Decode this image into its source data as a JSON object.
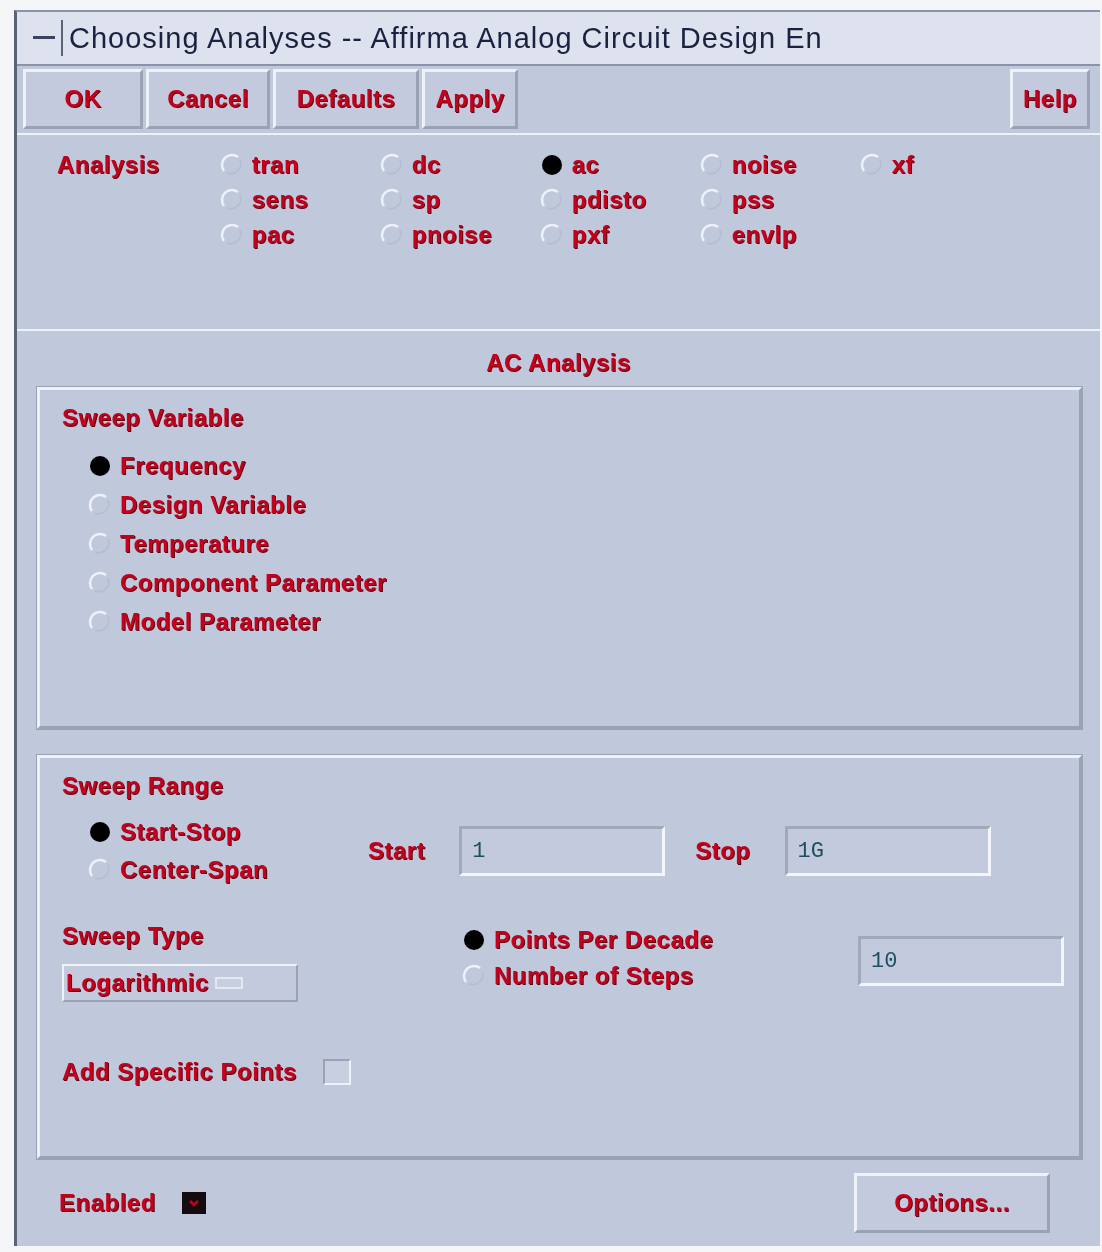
{
  "window": {
    "title": "Choosing Analyses -- Affirma Analog Circuit Design En"
  },
  "toolbar": {
    "left": [
      "OK",
      "Cancel",
      "Defaults",
      "Apply"
    ],
    "right": [
      "Help"
    ]
  },
  "analysis": {
    "label": "Analysis",
    "rows": [
      [
        {
          "label": "tran",
          "selected": false
        },
        {
          "label": "dc",
          "selected": false
        },
        {
          "label": "ac",
          "selected": true
        },
        {
          "label": "noise",
          "selected": false
        },
        {
          "label": "xf",
          "selected": false
        }
      ],
      [
        {
          "label": "sens",
          "selected": false
        },
        {
          "label": "sp",
          "selected": false
        },
        {
          "label": "pdisto",
          "selected": false
        },
        {
          "label": "pss",
          "selected": false
        }
      ],
      [
        {
          "label": "pac",
          "selected": false
        },
        {
          "label": "pnoise",
          "selected": false
        },
        {
          "label": "pxf",
          "selected": false
        },
        {
          "label": "envlp",
          "selected": false
        }
      ]
    ]
  },
  "section_title": "AC Analysis",
  "sweep_variable": {
    "title": "Sweep Variable",
    "options": [
      {
        "label": "Frequency",
        "selected": true
      },
      {
        "label": "Design Variable",
        "selected": false
      },
      {
        "label": "Temperature",
        "selected": false
      },
      {
        "label": "Component Parameter",
        "selected": false
      },
      {
        "label": "Model Parameter",
        "selected": false
      }
    ]
  },
  "sweep_range": {
    "title": "Sweep Range",
    "options": [
      {
        "label": "Start-Stop",
        "selected": true
      },
      {
        "label": "Center-Span",
        "selected": false
      }
    ],
    "start": {
      "label": "Start",
      "value": "1"
    },
    "stop": {
      "label": "Stop",
      "value": "1G"
    }
  },
  "sweep_type": {
    "title": "Sweep Type",
    "value": "Logarithmic",
    "step_options": [
      {
        "label": "Points Per Decade",
        "selected": true
      },
      {
        "label": "Number of Steps",
        "selected": false
      }
    ],
    "step_value": "10"
  },
  "add_specific_points": {
    "label": "Add Specific Points",
    "checked": false
  },
  "enabled": {
    "label": "Enabled",
    "checked": true
  },
  "options_button": "Options..."
}
